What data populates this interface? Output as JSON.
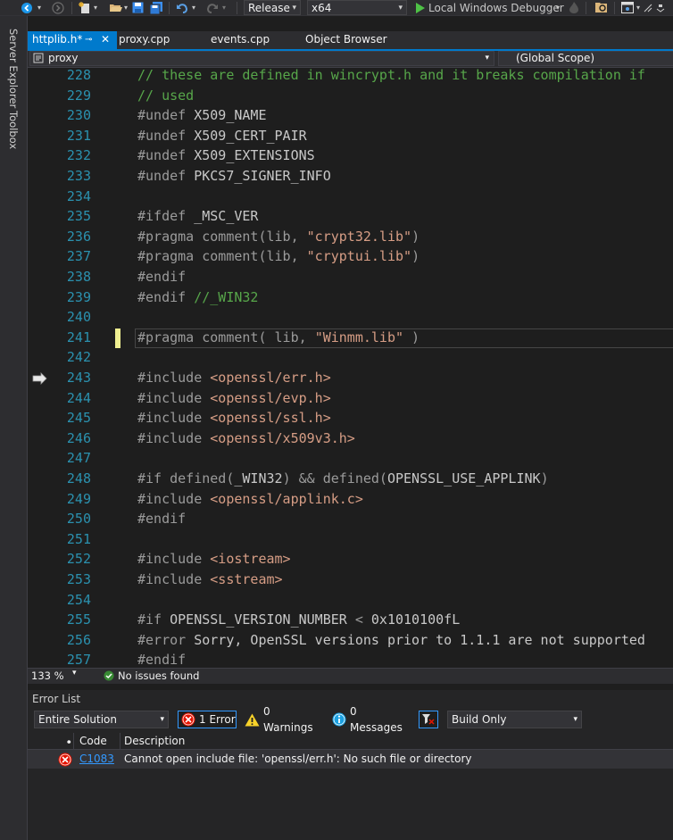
{
  "toolbar": {
    "configuration": "Release",
    "platform": "x64",
    "debugger_label": "Local Windows Debugger"
  },
  "sidebar": {
    "server_explorer": "Server Explorer",
    "toolbox": "Toolbox"
  },
  "tabs": [
    {
      "label": "httplib.h*",
      "active": true
    },
    {
      "label": "proxy.cpp",
      "active": false
    },
    {
      "label": "events.cpp",
      "active": false
    },
    {
      "label": "Object Browser",
      "active": false
    }
  ],
  "navbar": {
    "project": "proxy",
    "scope": "(Global Scope)"
  },
  "code_lines": [
    {
      "num": "228",
      "tokens": [
        {
          "t": "// these are defined in wincrypt.h and it breaks compilation if",
          "c": "comment"
        }
      ]
    },
    {
      "num": "229",
      "tokens": [
        {
          "t": "// used",
          "c": "comment"
        }
      ]
    },
    {
      "num": "230",
      "tokens": [
        {
          "t": "#undef ",
          "c": "pre"
        },
        {
          "t": "X509_NAME",
          "c": "txt"
        }
      ]
    },
    {
      "num": "231",
      "tokens": [
        {
          "t": "#undef ",
          "c": "pre"
        },
        {
          "t": "X509_CERT_PAIR",
          "c": "txt"
        }
      ]
    },
    {
      "num": "232",
      "tokens": [
        {
          "t": "#undef ",
          "c": "pre"
        },
        {
          "t": "X509_EXTENSIONS",
          "c": "txt"
        }
      ]
    },
    {
      "num": "233",
      "tokens": [
        {
          "t": "#undef ",
          "c": "pre"
        },
        {
          "t": "PKCS7_SIGNER_INFO",
          "c": "txt"
        }
      ]
    },
    {
      "num": "234",
      "tokens": []
    },
    {
      "num": "235",
      "tokens": [
        {
          "t": "#ifdef ",
          "c": "pre"
        },
        {
          "t": "_MSC_VER",
          "c": "txt"
        }
      ]
    },
    {
      "num": "236",
      "tokens": [
        {
          "t": "#pragma comment(lib, ",
          "c": "pre"
        },
        {
          "t": "\"crypt32.lib\"",
          "c": "str"
        },
        {
          "t": ")",
          "c": "pre"
        }
      ]
    },
    {
      "num": "237",
      "tokens": [
        {
          "t": "#pragma comment(lib, ",
          "c": "pre"
        },
        {
          "t": "\"cryptui.lib\"",
          "c": "str"
        },
        {
          "t": ")",
          "c": "pre"
        }
      ]
    },
    {
      "num": "238",
      "tokens": [
        {
          "t": "#endif",
          "c": "pre"
        }
      ]
    },
    {
      "num": "239",
      "tokens": [
        {
          "t": "#endif ",
          "c": "pre"
        },
        {
          "t": "//_WIN32",
          "c": "comment"
        }
      ]
    },
    {
      "num": "240",
      "tokens": []
    },
    {
      "num": "241",
      "tokens": [
        {
          "t": "#pragma comment( lib, ",
          "c": "pre"
        },
        {
          "t": "\"Winmm.lib\"",
          "c": "str"
        },
        {
          "t": " )",
          "c": "pre"
        }
      ]
    },
    {
      "num": "242",
      "tokens": []
    },
    {
      "num": "243",
      "tokens": [
        {
          "t": "#include ",
          "c": "pre"
        },
        {
          "t": "<openssl/err.h>",
          "c": "str"
        }
      ]
    },
    {
      "num": "244",
      "tokens": [
        {
          "t": "#include ",
          "c": "pre"
        },
        {
          "t": "<openssl/evp.h>",
          "c": "str"
        }
      ]
    },
    {
      "num": "245",
      "tokens": [
        {
          "t": "#include ",
          "c": "pre"
        },
        {
          "t": "<openssl/ssl.h>",
          "c": "str"
        }
      ]
    },
    {
      "num": "246",
      "tokens": [
        {
          "t": "#include ",
          "c": "pre"
        },
        {
          "t": "<openssl/x509v3.h>",
          "c": "str"
        }
      ]
    },
    {
      "num": "247",
      "tokens": []
    },
    {
      "num": "248",
      "tokens": [
        {
          "t": "#if defined(",
          "c": "pre"
        },
        {
          "t": "_WIN32",
          "c": "txt"
        },
        {
          "t": ") && defined(",
          "c": "pre"
        },
        {
          "t": "OPENSSL_USE_APPLINK",
          "c": "txt"
        },
        {
          "t": ")",
          "c": "pre"
        }
      ]
    },
    {
      "num": "249",
      "tokens": [
        {
          "t": "#include ",
          "c": "pre"
        },
        {
          "t": "<openssl/applink.c>",
          "c": "str"
        }
      ]
    },
    {
      "num": "250",
      "tokens": [
        {
          "t": "#endif",
          "c": "pre"
        }
      ]
    },
    {
      "num": "251",
      "tokens": []
    },
    {
      "num": "252",
      "tokens": [
        {
          "t": "#include ",
          "c": "pre"
        },
        {
          "t": "<iostream>",
          "c": "str"
        }
      ]
    },
    {
      "num": "253",
      "tokens": [
        {
          "t": "#include ",
          "c": "pre"
        },
        {
          "t": "<sstream>",
          "c": "str"
        }
      ]
    },
    {
      "num": "254",
      "tokens": []
    },
    {
      "num": "255",
      "tokens": [
        {
          "t": "#if ",
          "c": "pre"
        },
        {
          "t": "OPENSSL_VERSION_NUMBER",
          "c": "txt"
        },
        {
          "t": " < ",
          "c": "pre"
        },
        {
          "t": "0x1010100fL",
          "c": "txt"
        }
      ]
    },
    {
      "num": "256",
      "tokens": [
        {
          "t": "#error ",
          "c": "pre"
        },
        {
          "t": "Sorry, OpenSSL versions prior to 1.1.1 are not supported",
          "c": "txt"
        }
      ]
    },
    {
      "num": "257",
      "tokens": [
        {
          "t": "#endif",
          "c": "pre"
        }
      ]
    }
  ],
  "status": {
    "zoom": "133 %",
    "issues": "No issues found"
  },
  "error_list": {
    "title": "Error List",
    "scope": "Entire Solution",
    "errors": "1 Error",
    "warnings": "0 Warnings",
    "messages": "0 Messages",
    "build_filter": "Build Only",
    "col_code": "Code",
    "col_desc": "Description",
    "rows": [
      {
        "code": "C1083",
        "description": "Cannot open include file: 'openssl/err.h': No such file or directory"
      }
    ]
  }
}
